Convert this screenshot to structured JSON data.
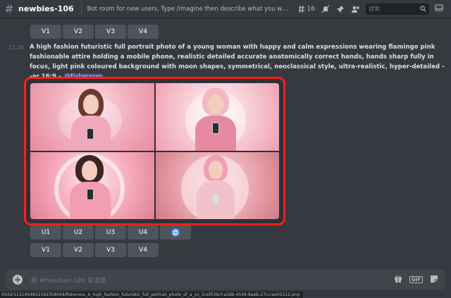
{
  "header": {
    "channel": "newbies-106",
    "topic": "Bot room for new users. Type /imagine then describe what you want to draw...",
    "thread_count": "16",
    "search_placeholder": "搜索"
  },
  "top_buttons": [
    "V1",
    "V2",
    "V3",
    "V4"
  ],
  "message": {
    "time": "22:24",
    "prompt": "A high fashion futuristic full portrait photo of a young woman with happy and calm expressions wearing flamingo pink fashionable attire holding a mobile phone, realistic detailed accurate anatomically correct hands, hands sharp fully in focus, light pink coloured background with moon shapes, symmetrical, neoclassical style, ultra-realistic, hyper-detailed --ar 16:9 -",
    "mention": "@Fisherxoxo"
  },
  "upscale_buttons": [
    "U1",
    "U2",
    "U3",
    "U4"
  ],
  "variation_buttons": [
    "V1",
    "V2",
    "V3",
    "V4"
  ],
  "refresh_icon": "refresh-icon",
  "input": {
    "placeholder": "给 #newbies-106 发消息"
  },
  "status_url": "0542/1131954832162358004/fisherxou_A_high_fashion_futuristic_full_portrait_photo_of_a_yo_2cef036cf-a3db-4546-8aeb-27cc/ae05312.png",
  "colors": {
    "background": "#36393f",
    "highlight_border": "#ff1d1d",
    "button": "#4f545c",
    "mention_bg": "#414675"
  }
}
